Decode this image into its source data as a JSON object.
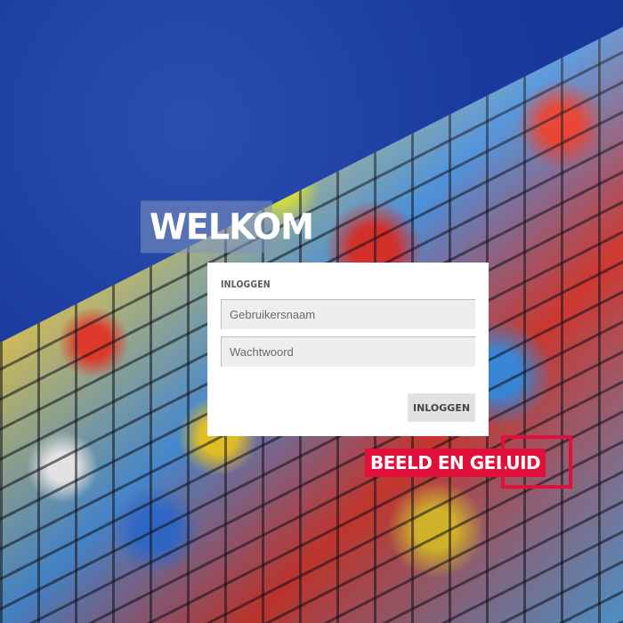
{
  "heading": {
    "text": "WELKOM"
  },
  "login": {
    "title": "INLOGGEN",
    "username_placeholder": "Gebruikersnaam",
    "password_placeholder": "Wachtwoord",
    "submit_label": "INLOGGEN"
  },
  "logo": {
    "text": "BEELD EN GELUID",
    "color": "#e0103a"
  },
  "colors": {
    "sky": "#1a3a9e",
    "panel": "#ffffff",
    "field": "#eeeeee"
  }
}
